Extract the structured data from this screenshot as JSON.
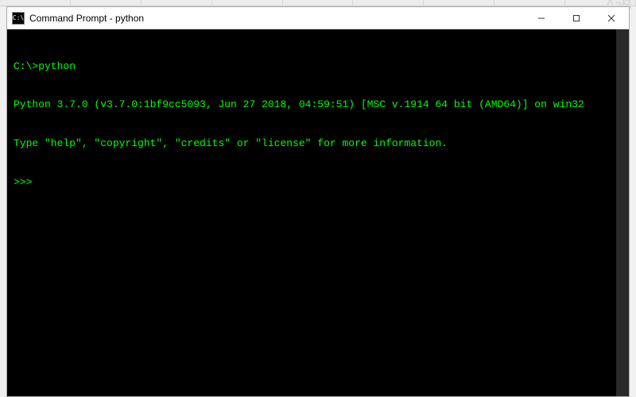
{
  "window": {
    "title": "Command Prompt - python",
    "icon_label": "C:\\"
  },
  "controls": {
    "minimize": "—",
    "maximize": "☐",
    "close": "✕"
  },
  "terminal": {
    "line1": "C:\\>python",
    "line2": "Python 3.7.0 (v3.7.0:1bf9cc5093, Jun 27 2018, 04:59:51) [MSC v.1914 64 bit (AMD64)] on win32",
    "line3": "Type \"help\", \"copyright\", \"credits\" or \"license\" for more information.",
    "prompt": ">>>"
  },
  "bg_hint": "AaB"
}
